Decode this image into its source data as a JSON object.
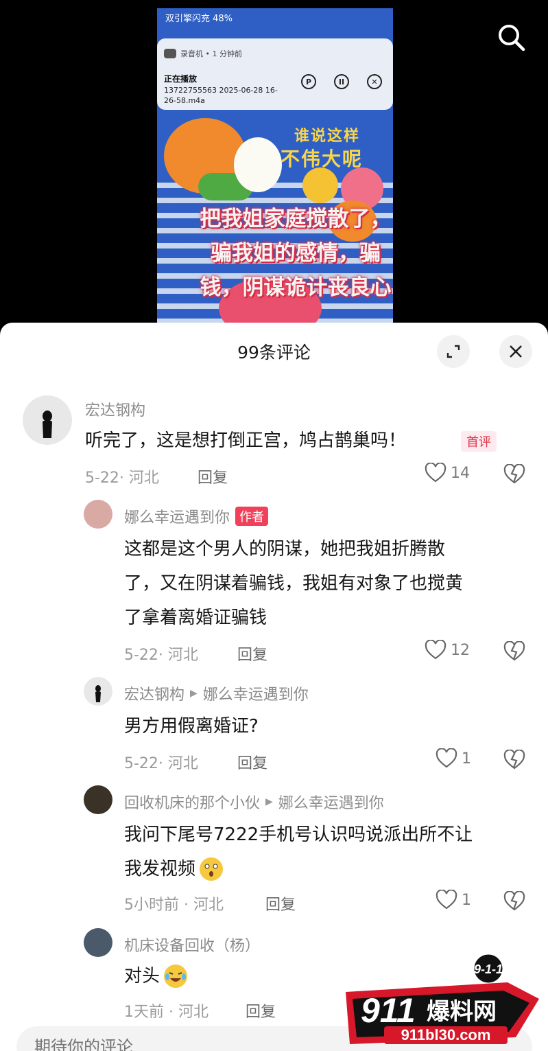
{
  "video": {
    "status_line": "双引擎闪充 48%",
    "notification": {
      "app": "录音机 • 1 分钟前",
      "title": "正在播放",
      "file": "13722755563 2025-06-28 16-26-58.m4a"
    },
    "poster_text": [
      "谁说这样",
      "不伟大呢"
    ],
    "caption": "把我姐家庭搅散了，骗我姐的感情，骗钱，阴谋诡计丧良心"
  },
  "sheet": {
    "title": "99条评论"
  },
  "comments": [
    {
      "name": "宏达钢构",
      "text": "听完了，这是想打倒正宫，鸠占鹊巢吗！",
      "badge": "首评",
      "meta": "5-22· 河北",
      "reply": "回复",
      "likes": "14"
    },
    {
      "name": "娜么幸运遇到你",
      "badge": "作者",
      "text_lines": [
        "这都是这个男人的阴谋，她把我姐折腾散",
        "了，又在阴谋着骗钱，我姐有对象了也搅黄",
        "了拿着离婚证骗钱"
      ],
      "meta": "5-22· 河北",
      "reply": "回复",
      "likes": "12"
    },
    {
      "name": "宏达钢构",
      "reply_to": "娜么幸运遇到你",
      "text": "男方用假离婚证?",
      "meta": "5-22· 河北",
      "reply": "回复",
      "likes": "1"
    },
    {
      "name": "回收机床的那个小伙",
      "reply_to": "娜么幸运遇到你",
      "text_lines": [
        "我问下尾号7222手机号认识吗说派出所不让",
        "我发视频"
      ],
      "meta": "5小时前 · 河北",
      "reply": "回复",
      "likes": "1"
    },
    {
      "name": "机床设备回收（杨）",
      "text": "对头",
      "meta": "1天前 · 河北",
      "reply": "回复"
    }
  ],
  "input": {
    "placeholder": "期待你的评论"
  },
  "watermark": {
    "badge": "9-1-1",
    "brand_num": "911",
    "brand_cn": "爆料网",
    "url": "911bl30.com"
  },
  "colors": {
    "accent": "#f0405a",
    "poster_blue": "#2f5fc4",
    "caption_red": "#e0344a"
  },
  "icons": [
    "search-icon",
    "pause-icon",
    "close-icon",
    "expand-icon",
    "heart-icon",
    "broken-heart-icon"
  ]
}
